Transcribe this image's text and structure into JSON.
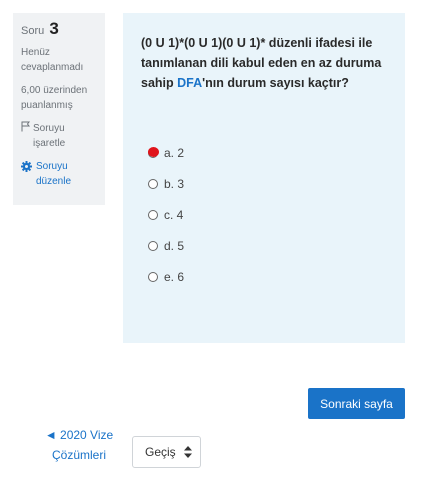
{
  "info": {
    "question_label": "Soru",
    "question_number": "3",
    "status": "Henüz cevaplanmadı",
    "points": "6,00 üzerinden puanlanmış",
    "flag_label": "Soruyu işaretle",
    "edit_label": "Soruyu düzenle"
  },
  "question": {
    "text_before": "(0 U 1)*(0 U 1)(0 U 1)*  düzenli ifadesi ile tanımlanan dili kabul eden en az duruma sahip ",
    "highlight": "DFA",
    "text_after": "'nın durum sayısı kaçtır?"
  },
  "answers": [
    {
      "label": "a. 2"
    },
    {
      "label": "b. 3"
    },
    {
      "label": "c. 4"
    },
    {
      "label": "d. 5"
    },
    {
      "label": "e. 6"
    }
  ],
  "navigation": {
    "next_label": "Sonraki sayfa",
    "prev_link": "◄ 2020 Vize Çözümleri",
    "jump_label": "Geçiş"
  },
  "colors": {
    "accent": "#1a73c8",
    "question_bg": "#e9f4fa",
    "info_bg": "#f0f2f4",
    "cursor_dot": "#e0141b"
  },
  "icons": [
    "flag-icon",
    "gear-icon",
    "sort-arrows-icon"
  ]
}
